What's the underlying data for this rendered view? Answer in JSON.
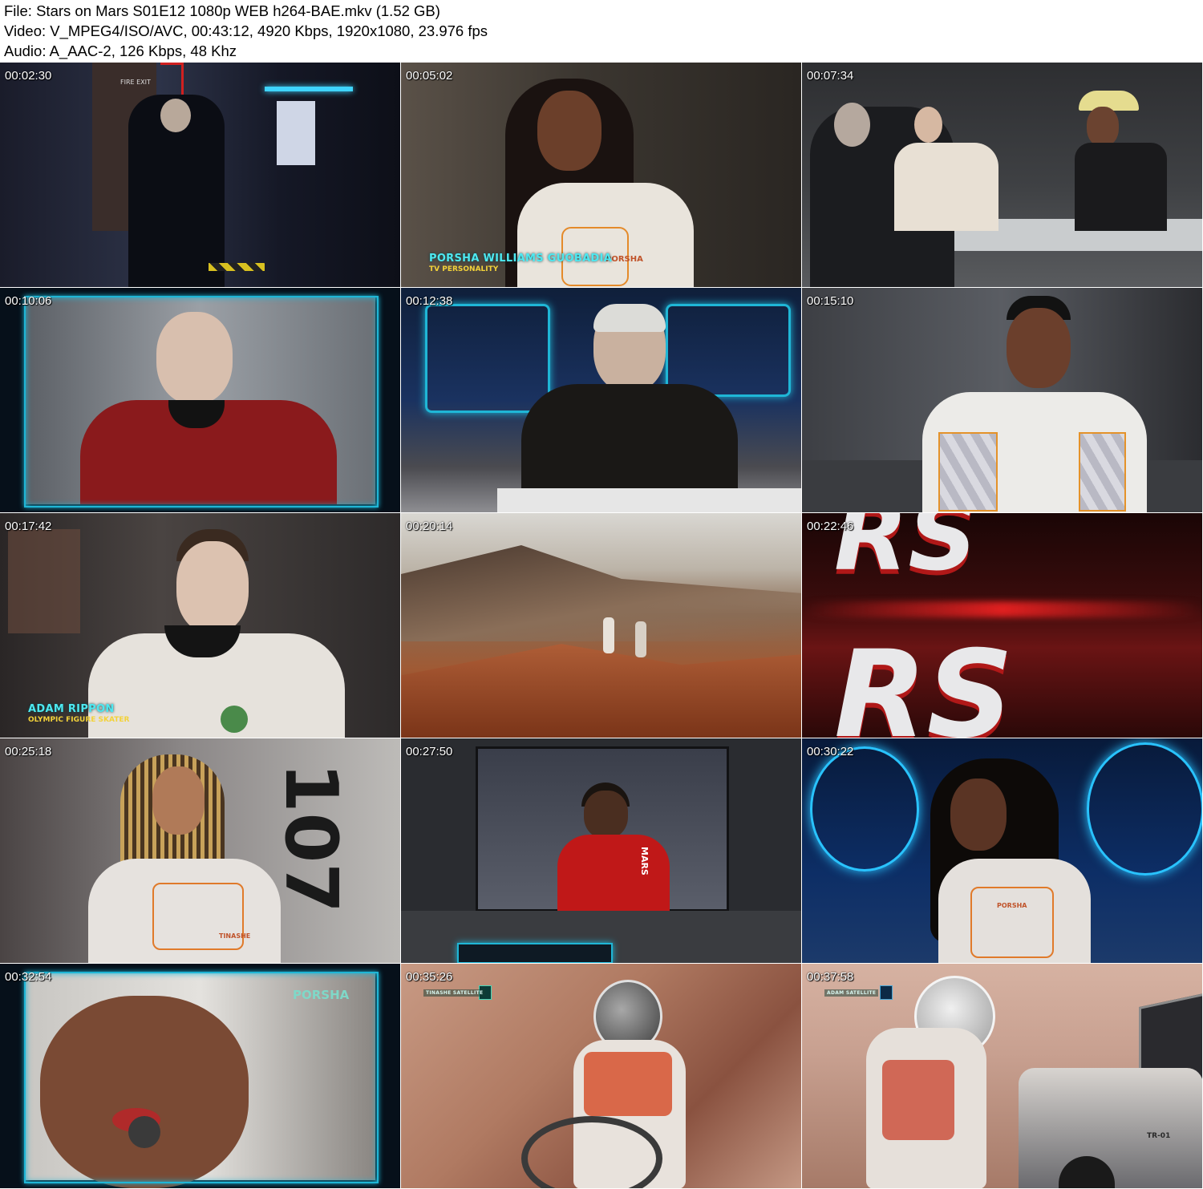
{
  "header": {
    "file_line": "File: Stars on Mars S01E12 1080p WEB h264-BAE.mkv (1.52 GB)",
    "video_line": "Video: V_MPEG4/ISO/AVC, 00:43:12, 4920 Kbps, 1920x1080, 23.976 fps",
    "audio_line": "Audio: A_AAC-2, 126 Kbps, 48 Khz"
  },
  "thumbnails": [
    {
      "timestamp": "00:02:30",
      "sign": "FIRE EXIT"
    },
    {
      "timestamp": "00:05:02",
      "name": "PORSHA WILLIAMS GUOBADIA",
      "role": "TV PERSONALITY",
      "suit": "PORSHA"
    },
    {
      "timestamp": "00:07:34"
    },
    {
      "timestamp": "00:10:06"
    },
    {
      "timestamp": "00:12:38"
    },
    {
      "timestamp": "00:15:10"
    },
    {
      "timestamp": "00:17:42",
      "name": "ADAM RIPPON",
      "role": "OLYMPIC FIGURE SKATER"
    },
    {
      "timestamp": "00:20:14"
    },
    {
      "timestamp": "00:22:46",
      "logo_top": "RS",
      "logo_bottom": "RS"
    },
    {
      "timestamp": "00:25:18",
      "wall_number": "107",
      "suit": "TINASHE"
    },
    {
      "timestamp": "00:27:50",
      "jacket": "MARS"
    },
    {
      "timestamp": "00:30:22",
      "suit": "PORSHA"
    },
    {
      "timestamp": "00:32:54",
      "hud_name": "PORSHA"
    },
    {
      "timestamp": "00:35:26",
      "hud": "TINASHE SATELLITE"
    },
    {
      "timestamp": "00:37:58",
      "hud": "ADAM SATELLITE",
      "vehicle": "TR-01"
    }
  ],
  "colors": {
    "hud_cyan": "#1fb6d6",
    "lower_third_name": "#4de8f0",
    "lower_third_role": "#f3d23a",
    "mars_red": "#c0532a"
  }
}
